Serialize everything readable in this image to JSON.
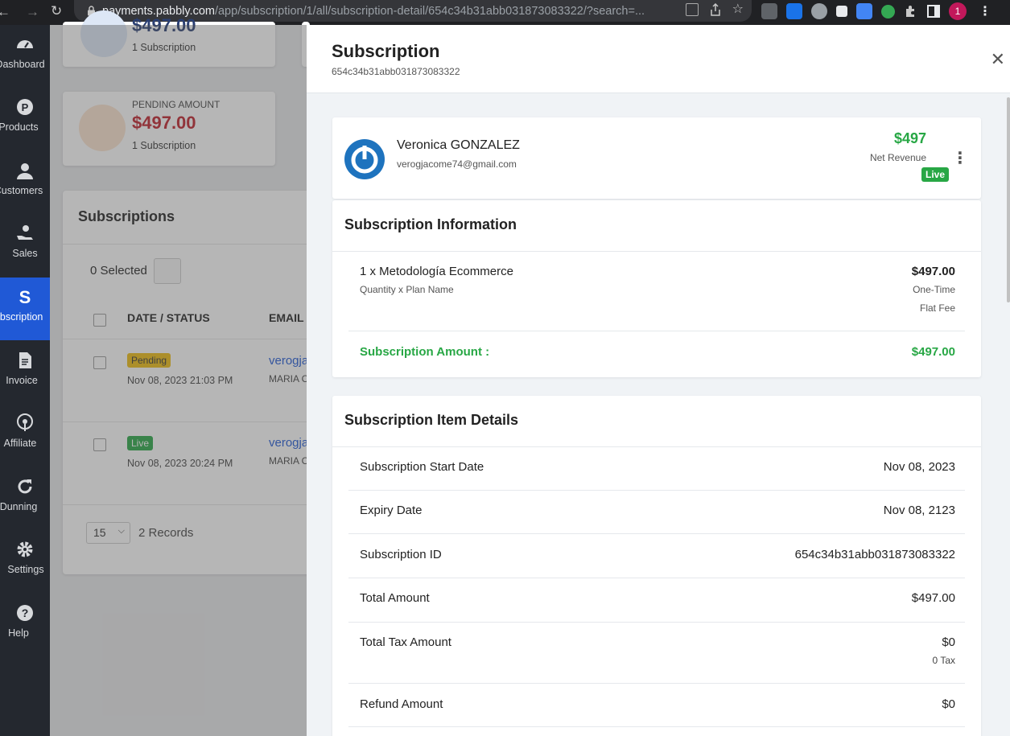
{
  "browser": {
    "url_host": "payments.pabbly.com",
    "url_path": "/app/subscription/1/all/subscription-detail/654c34b31abb031873083322/?search=...",
    "profile_initial": "1"
  },
  "sidebar": {
    "items": [
      {
        "label": "Dashboard"
      },
      {
        "label": "Products"
      },
      {
        "label": "Customers"
      },
      {
        "label": "Sales"
      },
      {
        "label": "Subscription"
      },
      {
        "label": "Invoice"
      },
      {
        "label": "Affiliate"
      },
      {
        "label": "Dunning"
      },
      {
        "label": "Settings"
      },
      {
        "label": "Help"
      }
    ]
  },
  "background": {
    "card1": {
      "amount": "$497.00",
      "sub": "1 Subscription"
    },
    "card2": {
      "label": "PENDING AMOUNT",
      "amount": "$497.00",
      "sub": "1 Subscription"
    },
    "list_title": "Subscriptions",
    "selected": "0 Selected",
    "col_date": "DATE / STATUS",
    "col_email": "EMAIL A",
    "rows": [
      {
        "status": "Pending",
        "date": "Nov 08, 2023 21:03 PM",
        "email": "verogja",
        "name": "MARIA C"
      },
      {
        "status": "Live",
        "date": "Nov 08, 2023 20:24 PM",
        "email": "verogja",
        "name": "MARIA C"
      }
    ],
    "page_size": "15",
    "records": "2 Records"
  },
  "panel": {
    "title": "Subscription",
    "subtitle": "654c34b31abb031873083322",
    "customer": {
      "name": "Veronica GONZALEZ",
      "email": "verogjacome74@gmail.com",
      "revenue": "$497",
      "revenue_label": "Net Revenue",
      "status": "Live"
    },
    "info": {
      "title": "Subscription Information",
      "plan": "1 x Metodología Ecommerce",
      "plan_caption": "Quantity x Plan Name",
      "price": "$497.00",
      "billing": "One-Time",
      "fee_type": "Flat Fee",
      "amount_label": "Subscription Amount :",
      "amount_value": "$497.00"
    },
    "details": {
      "title": "Subscription Item Details",
      "rows": [
        {
          "label": "Subscription Start Date",
          "value": "Nov 08, 2023"
        },
        {
          "label": "Expiry Date",
          "value": "Nov 08, 2123"
        },
        {
          "label": "Subscription ID",
          "value": "654c34b31abb031873083322"
        },
        {
          "label": "Total Amount",
          "value": "$497.00"
        },
        {
          "label": "Total Tax Amount",
          "value": "$0",
          "note": "0 Tax"
        },
        {
          "label": "Refund Amount",
          "value": "$0"
        }
      ]
    }
  },
  "colors": {
    "accent": "#2059d6",
    "green": "#28a745",
    "red": "#c0202a",
    "sidebar": "#24282f"
  }
}
